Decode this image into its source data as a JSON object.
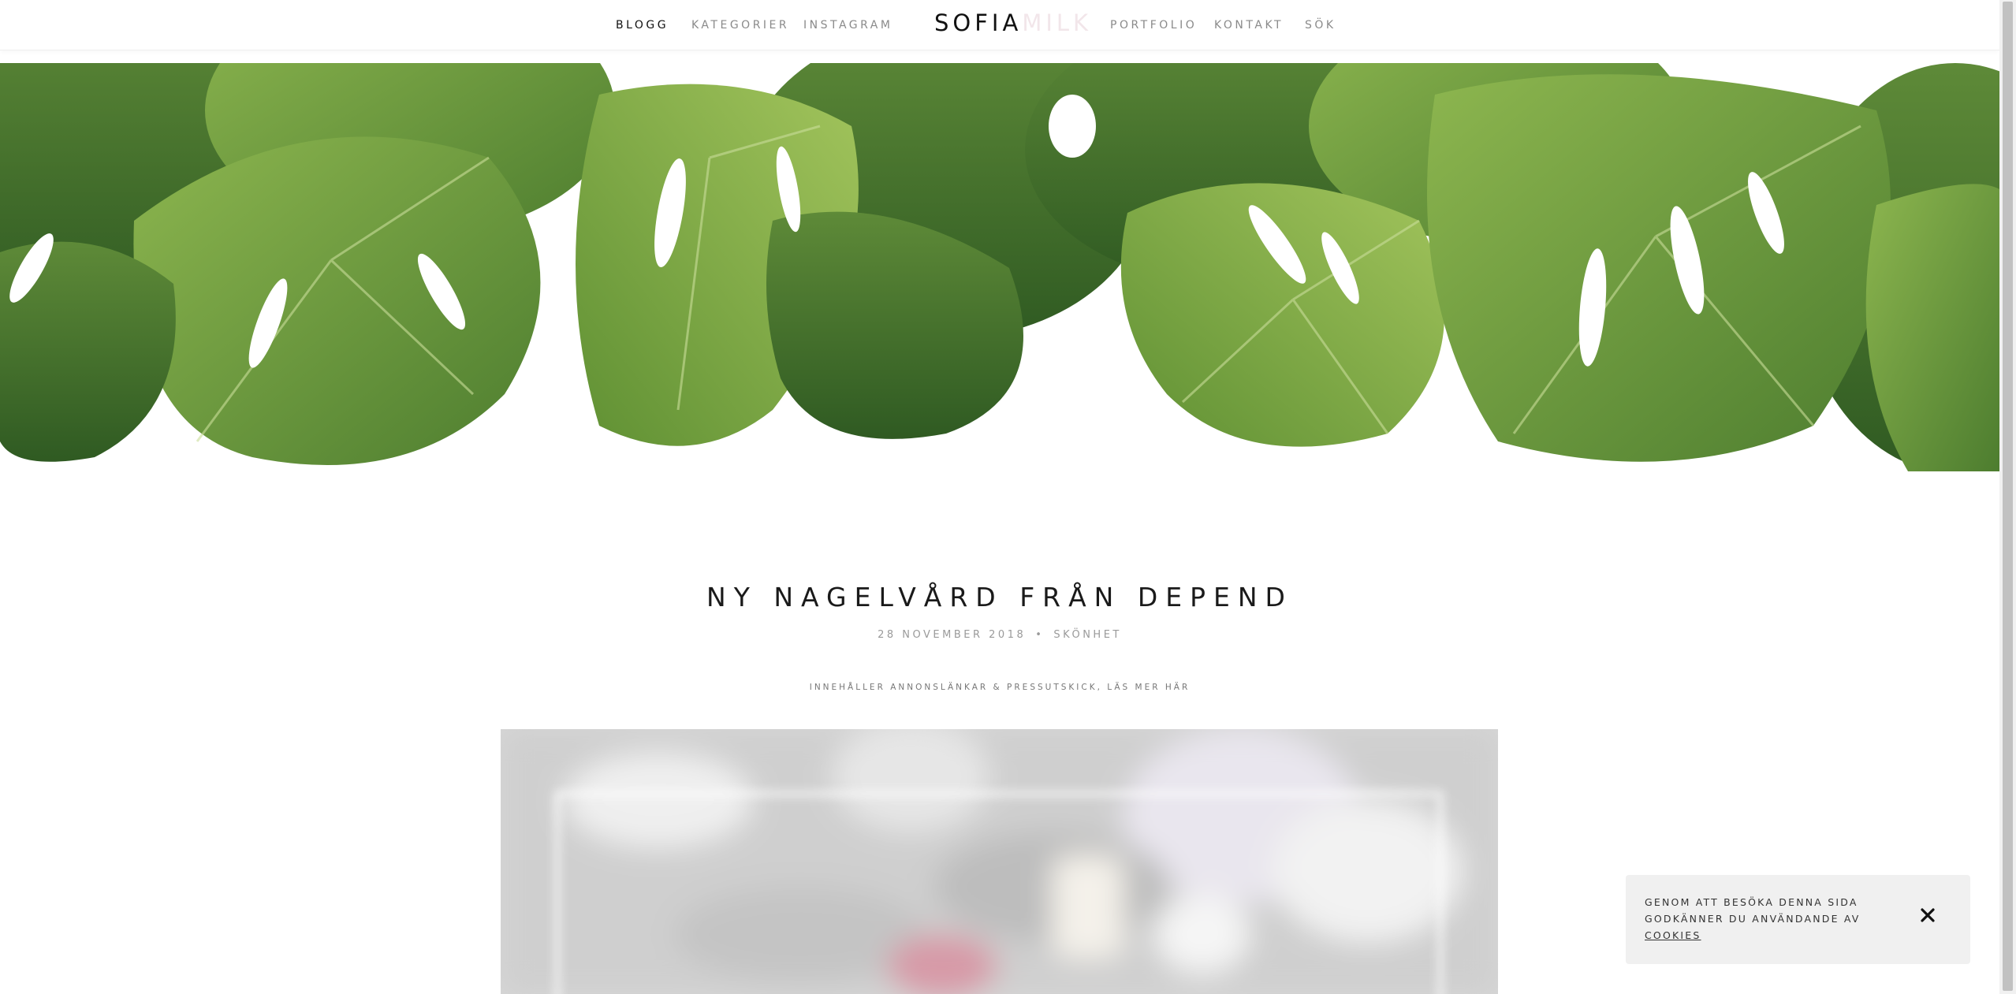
{
  "nav": {
    "left_items": [
      {
        "label": "BLOGG",
        "active": true
      },
      {
        "label": "KATEGORIER",
        "active": false
      },
      {
        "label": "INSTAGRAM",
        "active": false
      }
    ],
    "right_items": [
      {
        "label": "PORTFOLIO"
      },
      {
        "label": "KONTAKT"
      },
      {
        "label": "SÖK"
      }
    ],
    "logo": {
      "part1": "SOFIA",
      "part2": "MILK"
    }
  },
  "hero": {
    "image": "monstera-leaves-banner"
  },
  "post": {
    "title": "NY NAGELVÅRD FRÅN DEPEND",
    "date": "28 NOVEMBER 2018",
    "separator": "•",
    "category": "SKÖNHET",
    "disclosure": "INNEHÅLLER ANNONSLÄNKAR & PRESSUTSKICK, LÄS MER HÄR",
    "image": "blurred-nail-polish-photo"
  },
  "cookie_banner": {
    "line1": "GENOM ATT BESÖKA DENNA SIDA",
    "line2": "GODKÄNNER DU ANVÄNDANDE AV",
    "link": "COOKIES",
    "close_icon": "close-icon"
  },
  "colors": {
    "logo_accent": "#f2e6ea",
    "leaf_dark": "#3f6b2c",
    "leaf_light": "#7fa544",
    "cookie_bg": "#f0f0f0"
  }
}
